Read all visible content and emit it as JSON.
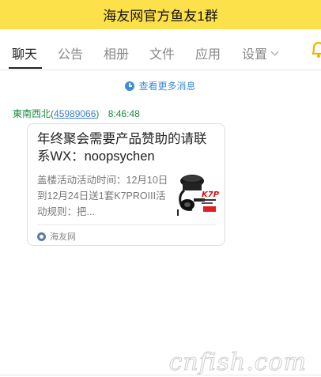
{
  "window": {
    "title": "海友网官方鱼友1群"
  },
  "tabs": [
    {
      "label": "聊天",
      "active": true
    },
    {
      "label": "公告"
    },
    {
      "label": "相册"
    },
    {
      "label": "文件"
    },
    {
      "label": "应用"
    },
    {
      "label": "设置"
    }
  ],
  "chat": {
    "more_messages": "查看更多消息",
    "message": {
      "sender_name": "東南西北",
      "sender_id_open": "(",
      "sender_id": "45989066",
      "sender_id_close": ")",
      "time": "8:46:48",
      "card": {
        "title": "年终聚会需要产品赞助的请联系WX：noopsychen",
        "description": "盖楼活动活动时间：12月10日到12月24日送1套K7PROIII活动规则：把...",
        "source": "海友网",
        "thumb_brand": "K7P"
      }
    }
  },
  "watermark": "cnfish.com",
  "colors": {
    "title_bar": "#fde14a",
    "link_blue": "#3b8fd8",
    "sender_green": "#1a8a3c"
  }
}
